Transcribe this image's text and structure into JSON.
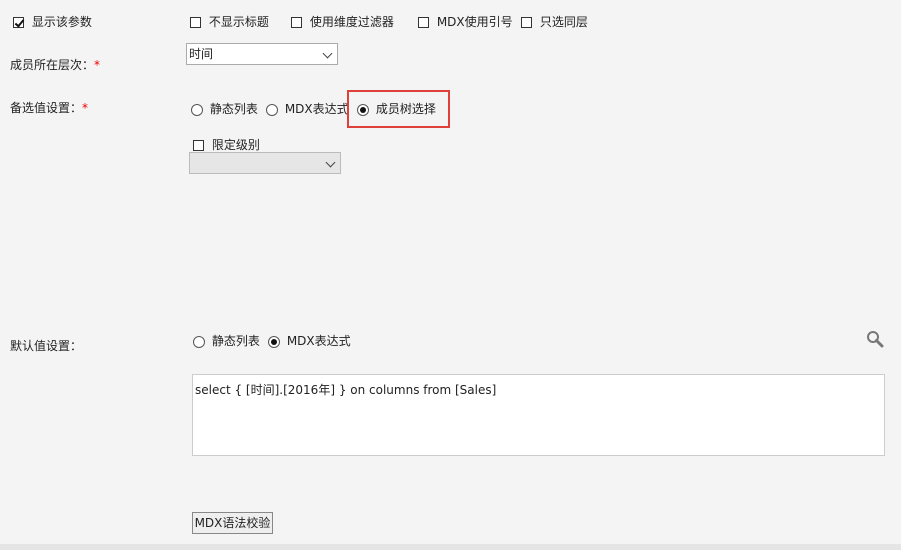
{
  "display_options": {
    "show_param": {
      "label": "显示该参数",
      "checked": true
    },
    "hide_title": {
      "label": "不显示标题",
      "checked": false
    },
    "use_dim_filter": {
      "label": "使用维度过滤器",
      "checked": false
    },
    "mdx_quote": {
      "label": "MDX使用引号",
      "checked": false
    },
    "same_level_only": {
      "label": "只选同层",
      "checked": false
    }
  },
  "member_level": {
    "label": "成员所在层次：",
    "required_mark": "*",
    "selected": "时间"
  },
  "candidate_setting": {
    "label": "备选值设置：",
    "required_mark": "*",
    "options": [
      {
        "label": "静态列表",
        "checked": false
      },
      {
        "label": "MDX表达式",
        "checked": false
      },
      {
        "label": "成员树选择",
        "checked": true
      }
    ],
    "limit_level": {
      "label": "限定级别",
      "checked": false
    },
    "level_select_value": ""
  },
  "default_setting": {
    "label": "默认值设置：",
    "options": [
      {
        "label": "静态列表",
        "checked": false
      },
      {
        "label": "MDX表达式",
        "checked": true
      }
    ],
    "expression": "select { [时间].[2016年] } on columns from [Sales]",
    "search_icon": "magnifier-icon",
    "validate_button": "MDX语法校验"
  },
  "colors": {
    "highlight": "#e0403a",
    "required": "#ee0000"
  }
}
